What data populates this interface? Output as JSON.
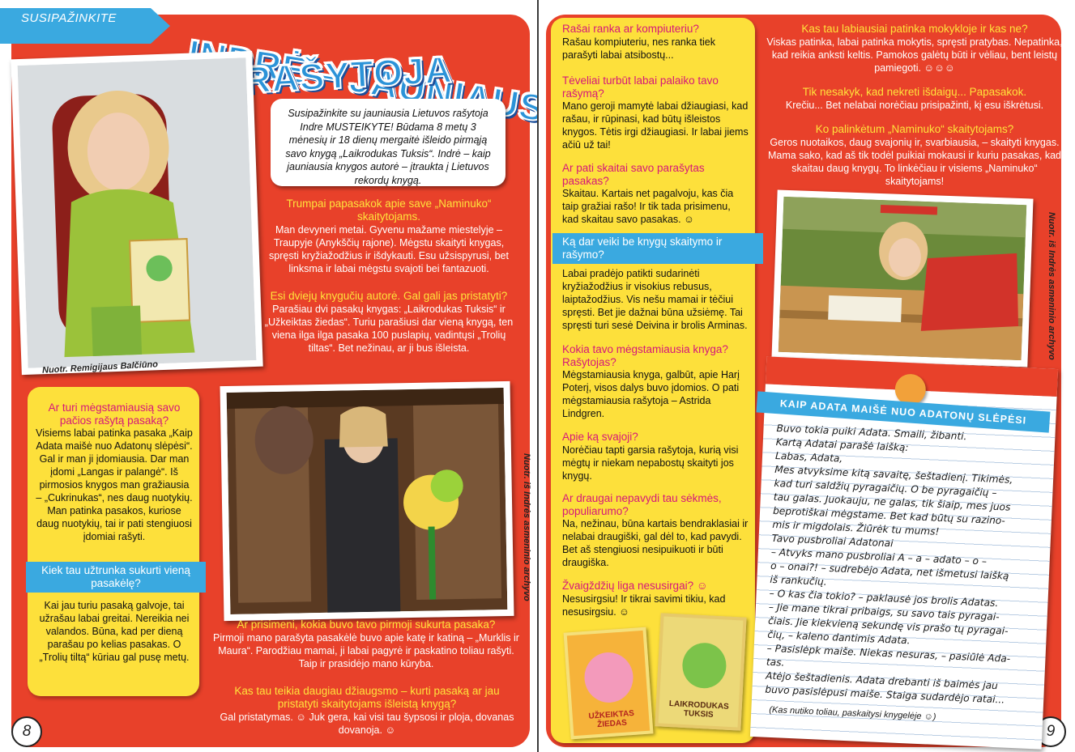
{
  "left_page": {
    "section_tag": "SUSIPAŽINKITE",
    "title_line1": "INDRĖ – JAUNIAUSIA",
    "title_line2": "RAŠYTOJA",
    "intro": "Susipažinkite su jauniausia Lietuvos rašytoja Indre MUSTEIKYTE! Būdama 8 metų 3 mėnesių ir 18 dienų mergaitė išleido pirmąją savo knygą „Laikrodukas Tuksis“. Indrė – kaip jauniausia knygos autorė – įtraukta į Lietuvos rekordų knygą.",
    "photo1_credit": "Nuotr. Remigijaus Balčiūno",
    "photo2_credit": "Nuotr. iš Indrės asmeninio archyvo",
    "qa1_q": "Trumpai papasakok apie save „Naminuko“ skaitytojams.",
    "qa1_a": "Man devyneri metai. Gyvenu mažame miestelyje – Traupyje (Anykščių rajone). Mėgstu skaityti knygas, spręsti kryžiažodžius ir išdykauti. Esu užsispyrusi, bet linksma ir labai mėgstu svajoti bei fantazuoti.",
    "qa2_q": "Esi dviejų knygučių autorė. Gal gali jas pristatyti?",
    "qa2_a": "Parašiau dvi pasakų knygas: „Laikrodukas Tuksis“ ir „Užkeiktas žiedas“. Turiu parašiusi dar vieną knygą, ten viena ilga ilga pasaka 100 puslapių, vadintųsi „Trolių tiltas“. Bet nežinau, ar ji bus išleista.",
    "box_q": "Ar turi mėgstamiausią savo pačios rašytą pasaką?",
    "box_a": "Visiems labai patinka pasaka „Kaip Adata maišė nuo Adatonų slėpėsi“. Gal ir man ji įdomiausia. Dar man įdomi „Langas ir palangė“. Iš pirmosios knygos man gražiausia – „Cukrinukas“, nes daug nuotykių. Man patinka pasakos, kuriose daug nuotykių, tai ir pati stengiuosi įdomiai rašyti.",
    "ribbon_q": "Kiek tau užtrunka sukurti vieną pasakėlę?",
    "ribbon_a": "Kai jau turiu pasaką galvoje, tai užrašau labai greitai. Nereikia nei valandos. Būna, kad per dieną parašau po kelias pasakas. O „Trolių tiltą“ kūriau gal pusę metų.",
    "qa3_q": "Ar prisimeni, kokia buvo tavo pirmoji sukurta pasaka?",
    "qa3_a": "Pirmoji mano parašyta pasakėlė buvo apie katę ir katiną – „Murklis ir Maura“. Parodžiau mamai, ji labai pagyrė ir paskatino toliau rašyti. Taip ir prasidėjo mano kūryba.",
    "qa4_q": "Kas tau teikia daugiau džiaugsmo – kurti pasaką ar jau pristatyti skaitytojams išleistą knygą?",
    "qa4_a": "Gal pristatymas. ☺ Juk gera, kai visi tau šypsosi ir ploja, dovanas dovanoja. ☺",
    "page_number": "8"
  },
  "right_page": {
    "yq1": "Rašai ranka ar kompiuteriu?",
    "ya1": "Rašau kompiuteriu, nes ranka tiek parašyti labai atsibostų...",
    "yq2": "Tėveliai turbūt labai palaiko tavo rašymą?",
    "ya2": "Mano geroji mamytė labai džiaugiasi, kad rašau, ir rūpinasi, kad būtų išleistos knygos. Tėtis irgi džiaugiasi. Ir labai jiems ačiū už tai!",
    "yq3": "Ar pati skaitai savo parašytas pasakas?",
    "ya3": "Skaitau. Kartais net pagalvoju, kas čia taip gražiai rašo! Ir tik tada prisimenu, kad skaitau savo pasakas. ☺",
    "yribbon": "Ką dar veiki be knygų skaitymo ir rašymo?",
    "ya4": "Labai pradėjo patikti sudarinėti kryžiažodžius ir visokius rebusus, laiptažodžius. Vis nešu mamai ir tėčiui spręsti. Bet jie dažnai būna užsiėmę. Tai spręsti turi sesė Deivina ir brolis Arminas.",
    "yq5": "Kokia tavo mėgstamiausia knyga? Rašytojas?",
    "ya5": "Mėgstamiausia knyga, galbūt, apie Harį Poterį, visos dalys buvo įdomios. O pati mėgstamiausia rašytoja – Astrida Lindgren.",
    "yq6": "Apie ką svajoji?",
    "ya6": "Norėčiau tapti garsia rašytoja, kurią visi mėgtų ir niekam nepabostų skaityti jos knygų.",
    "yq7": "Ar draugai nepavydi tau sėkmės, populiarumo?",
    "ya7": "Na, nežinau, būna kartais bendraklasiai ir nelabai draugiški, gal dėl to, kad pavydi. Bet aš stengiuosi nesipuikuoti ir būti draugiška.",
    "yq8": "Žvaigždžių liga nesusirgai? ☺",
    "ya8": "Nesusirgsiu! Ir tikrai savimi tikiu, kad nesusirgsiu. ☺",
    "rq1": "Kas tau labiausiai patinka mokykloje ir kas ne?",
    "ra1": "Viskas patinka, labai patinka mokytis, spręsti pratybas. Nepatinka, kad reikia anksti keltis. Pamokos galėtų būti ir vėliau, bent leistų pamiegoti. ☺☺☺",
    "rq2": "Tik nesakyk, kad nekreti išdaigų... Papasakok.",
    "ra2": "Krečiu... Bet nelabai norėčiau prisipažinti, kį esu iškrėtusi.",
    "rq3": "Ko palinkėtum „Naminuko“ skaitytojams?",
    "ra3": "Geros nuotaikos, daug svajonių ir, svarbiausia, – skaityti knygas. Mama sako, kad aš tik todėl puikiai mokausi ir kuriu pasakas, kad skaitau daug knygų. To linkėčiau ir visiems „Naminuko“ skaitytojams!",
    "photo_credit": "Nuotr. iš Indrės asmeninio archyvo",
    "notebook_title": "KAIP ADATA MAIŠĖ NUO ADATONŲ SLĖPĖSI",
    "notebook_lines": [
      "Buvo tokia puiki Adata. Smaili, žibanti.",
      "Kartą Adatai parašė laišką:",
      "Labas, Adata,",
      "Mes atvyksime kitą savaitę, šeštadienį. Tikimės,",
      "kad turi saldžių pyragaičių. O be pyragaičių –",
      "tau galas. Juokauju, ne galas, tik šiaip, mes juos",
      "beprotiškai mėgstame. Bet kad būtų su razino-",
      "mis ir migdolais. Žiūrėk tu mums!",
      "Tavo pusbroliai Adatonai",
      "– Atvyks mano pusbroliai A – a – adato – o –",
      "o – onai?! – sudrebėjo Adata, net išmetusi laišką",
      "iš rankučių.",
      "– O kas čia tokio? – paklausė jos brolis Adatas.",
      "– Jie mane tikrai pribaigs, su savo tais pyragai-",
      "čiais. Jie kiekvieną sekundę vis prašo tų pyragai-",
      "čių, – kaleno dantimis Adata.",
      "– Pasislėpk maiše. Niekas nesuras, – pasiūlė Ada-",
      "tas.",
      "Atėjo šeštadienis. Adata drebanti iš baimės jau",
      "buvo pasislėpusi maiše. Staiga sudardėjo ratai..."
    ],
    "notebook_footer": "(Kas nutiko toliau, paskaitysi knygelėje ☺)",
    "book1_title": "UŽKEIKTAS ŽIEDAS",
    "book2_title": "LAIKRODUKAS TUKSIS",
    "page_number": "9"
  },
  "colors": {
    "red": "#e8412a",
    "yellow": "#fde03b",
    "blue": "#3aa9e0",
    "question_yellow": "#ffe23b",
    "question_magenta": "#d5177a"
  }
}
